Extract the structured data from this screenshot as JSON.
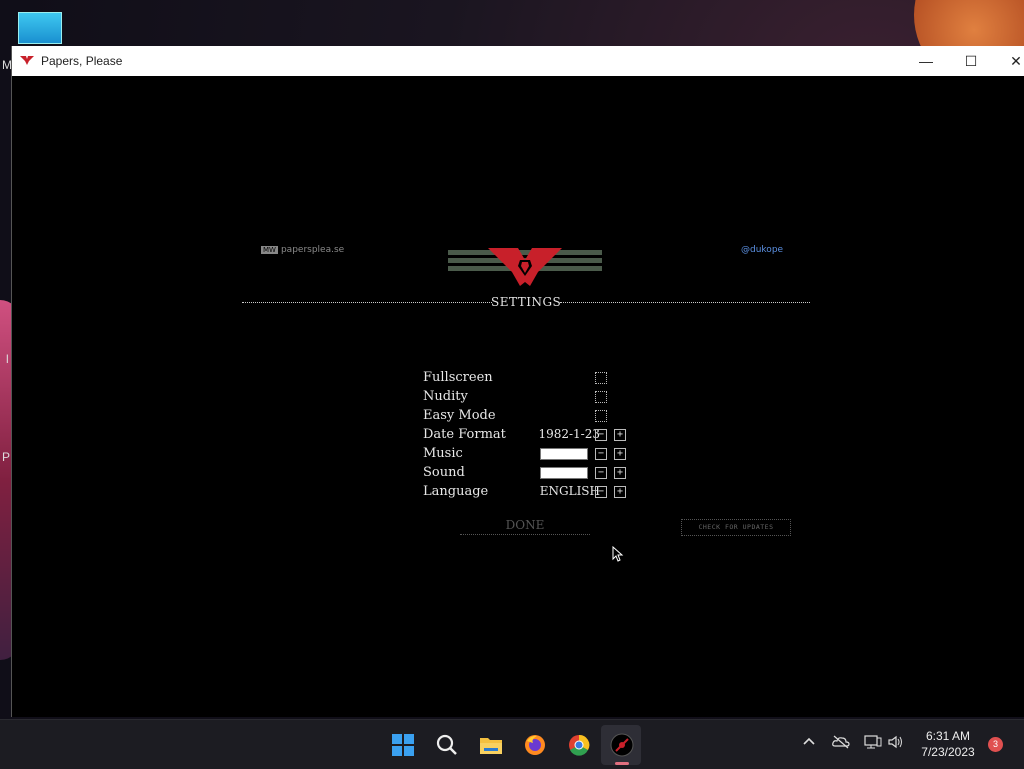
{
  "desktop": {
    "letters": [
      "M",
      "l",
      "P"
    ]
  },
  "window": {
    "title": "Papers, Please",
    "controls": {
      "minimize": "—",
      "maximize": "☐",
      "close": "✕"
    }
  },
  "game": {
    "site_link_tag": "MW",
    "site_link": "papersplea.se",
    "twitter_link": "@dukope",
    "settings_title": "SETTINGS",
    "settings": [
      {
        "label": "Fullscreen",
        "control": "checkbox",
        "checked": false
      },
      {
        "label": "Nudity",
        "control": "checkbox",
        "checked": false
      },
      {
        "label": "Easy Mode",
        "control": "checkbox",
        "checked": false
      },
      {
        "label": "Date Format",
        "control": "stepper",
        "value": "1982-1-23"
      },
      {
        "label": "Music",
        "control": "slider",
        "level": 1.0
      },
      {
        "label": "Sound",
        "control": "slider",
        "level": 1.0
      },
      {
        "label": "Language",
        "control": "stepper",
        "value": "ENGLISH"
      }
    ],
    "done_label": "DONE",
    "updates_label": "CHECK FOR UPDATES",
    "colors": {
      "emblem_red": "#c8202a",
      "emblem_green": "#4a5a4a",
      "link_blue": "#5b8fe0"
    }
  },
  "taskbar": {
    "icons": [
      "windows-start-icon",
      "search-icon",
      "file-explorer-icon",
      "firefox-icon",
      "chrome-icon",
      "papers-please-icon"
    ],
    "clock_time": "6:31 AM",
    "clock_date": "7/23/2023",
    "notification_count": "3"
  }
}
